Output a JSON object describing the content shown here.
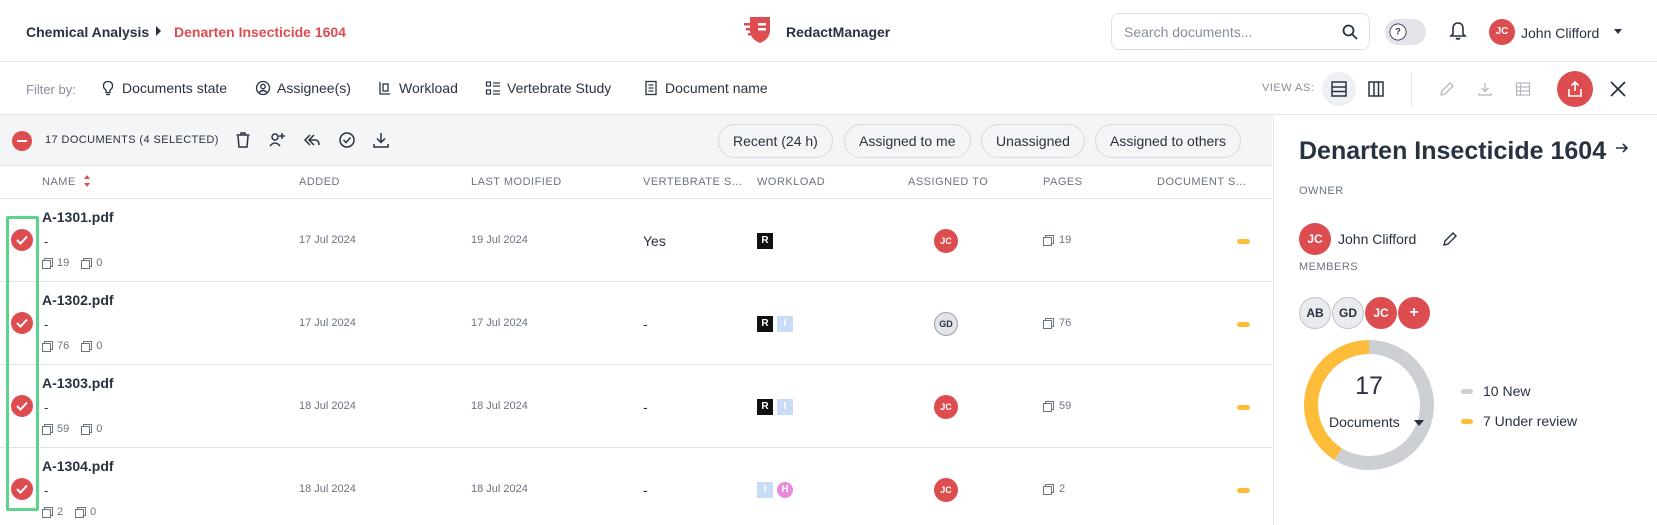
{
  "header": {
    "breadcrumb_parent": "Chemical Analysis",
    "breadcrumb_current": "Denarten Insecticide 1604",
    "app_name": "RedactManager",
    "search_placeholder": "Search documents...",
    "help_label": "?",
    "user_initials": "JC",
    "user_name": "John Clifford"
  },
  "filters": {
    "label": "Filter by:",
    "items": [
      "Documents state",
      "Assignee(s)",
      "Workload",
      "Vertebrate Study",
      "Document name"
    ],
    "view_as": "VIEW AS:"
  },
  "list": {
    "count_label": "17 DOCUMENTS (4 SELECTED)",
    "quick_filters": [
      "Recent (24 h)",
      "Assigned to me",
      "Unassigned",
      "Assigned to others"
    ],
    "columns": [
      "NAME",
      "ADDED",
      "LAST MODIFIED",
      "VERTEBRATE S...",
      "WORKLOAD",
      "ASSIGNED TO",
      "PAGES",
      "DOCUMENT S..."
    ],
    "rows": [
      {
        "name": "A-1301.pdf",
        "sub": "-",
        "pages": "19",
        "annotations": "0",
        "added": "17 Jul 2024",
        "modified": "19 Jul 2024",
        "vertebrate": "Yes",
        "workload": [
          "R"
        ],
        "assignee": "JC",
        "page_count": "19"
      },
      {
        "name": "A-1302.pdf",
        "sub": "-",
        "pages": "76",
        "annotations": "0",
        "added": "17 Jul 2024",
        "modified": "17 Jul 2024",
        "vertebrate": "-",
        "workload": [
          "R",
          "I"
        ],
        "assignee": "GD",
        "page_count": "76"
      },
      {
        "name": "A-1303.pdf",
        "sub": "-",
        "pages": "59",
        "annotations": "0",
        "added": "18 Jul 2024",
        "modified": "18 Jul 2024",
        "vertebrate": "-",
        "workload": [
          "R",
          "I"
        ],
        "assignee": "JC",
        "page_count": "59"
      },
      {
        "name": "A-1304.pdf",
        "sub": "-",
        "pages": "2",
        "annotations": "0",
        "added": "18 Jul 2024",
        "modified": "18 Jul 2024",
        "vertebrate": "-",
        "workload": [
          "I",
          "H"
        ],
        "assignee": "JC",
        "page_count": "2"
      }
    ]
  },
  "panel": {
    "title": "Denarten Insecticide 1604",
    "owner_label": "OWNER",
    "owner_initials": "JC",
    "owner_name": "John Clifford",
    "members_label": "MEMBERS",
    "members": [
      "AB",
      "GD",
      "JC",
      "+"
    ],
    "total": "17",
    "total_label": "Documents",
    "legend": [
      {
        "label": "10 New",
        "value": 10,
        "color": "#cccfd4"
      },
      {
        "label": "7 Under review",
        "value": 7,
        "color": "#fdbd3a"
      }
    ]
  },
  "colors": {
    "accent": "#dd4d50",
    "under_review": "#fdbd3a",
    "selection_outline": "#5ed38b"
  }
}
